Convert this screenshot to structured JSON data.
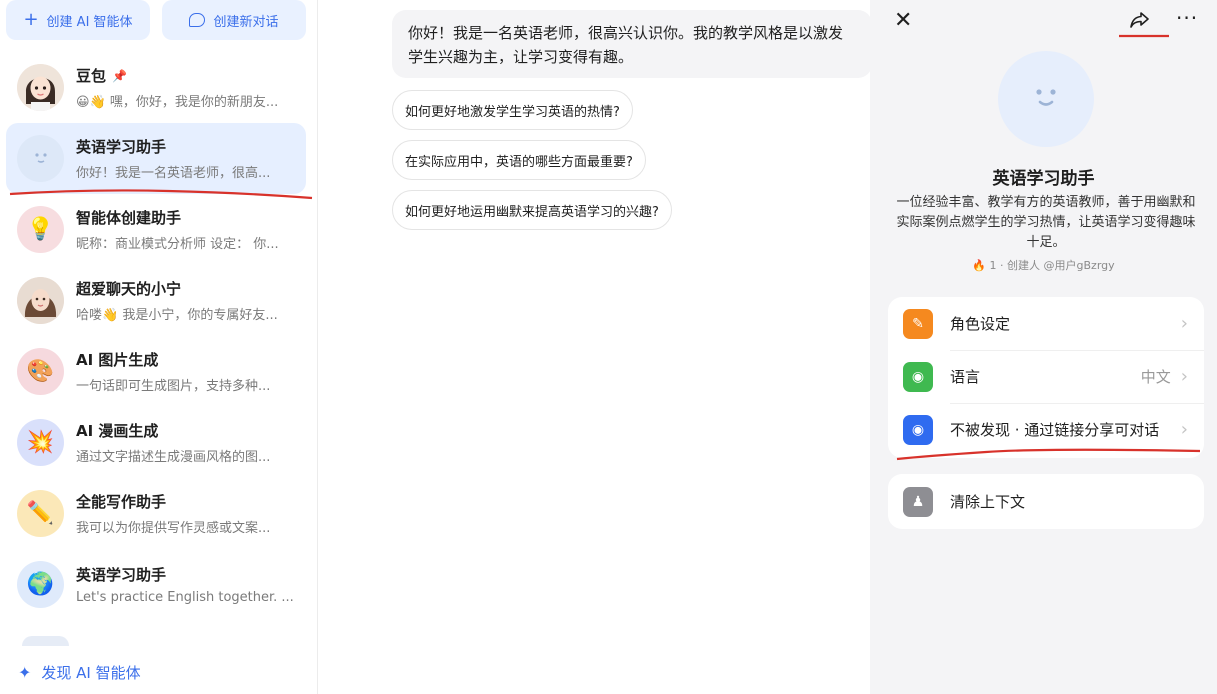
{
  "sidebar": {
    "create_agent_label": "创建 AI 智能体",
    "new_chat_label": "创建新对话",
    "agents": [
      {
        "name": "豆包",
        "desc": "😀👋 嘿，你好，我是你的新朋友...",
        "avatar": "girl",
        "pinned": true
      },
      {
        "name": "英语学习助手",
        "desc": "你好！我是一名英语老师，很高...",
        "avatar": "smile",
        "active": true
      },
      {
        "name": "智能体创建助手",
        "desc": "昵称：商业模式分析师 设定： 你...",
        "avatar": "bulb"
      },
      {
        "name": "超爱聊天的小宁",
        "desc": "哈喽👋 我是小宁，你的专属好友...",
        "avatar": "woman"
      },
      {
        "name": "AI 图片生成",
        "desc": "一句话即可生成图片，支持多种...",
        "avatar": "palette"
      },
      {
        "name": "AI 漫画生成",
        "desc": "通过文字描述生成漫画风格的图...",
        "avatar": "boom"
      },
      {
        "name": "全能写作助手",
        "desc": "我可以为你提供写作灵感或文案...",
        "avatar": "pencil"
      },
      {
        "name": "英语学习助手",
        "desc": "Let's practice English together. ...",
        "avatar": "globe"
      }
    ],
    "discover_label": "发现 AI 智能体"
  },
  "chat": {
    "greeting": "你好！我是一名英语老师，很高兴认识你。我的教学风格是以激发学生兴趣为主，让学习变得有趣。",
    "suggestions": [
      "如何更好地激发学生学习英语的热情?",
      "在实际应用中，英语的哪些方面最重要?",
      "如何更好地运用幽默来提高英语学习的兴趣?"
    ]
  },
  "panel": {
    "title": "英语学习助手",
    "description": "一位经验丰富、教学有方的英语教师，善于用幽默和实际案例点燃学生的学习热情，让英语学习变得趣味十足。",
    "meta": "1 · 创建人 @用户gBzrgy",
    "settings": [
      {
        "label": "角色设定",
        "value": "",
        "color": "#f5891f"
      },
      {
        "label": "语言",
        "value": "中文",
        "color": "#3fb950"
      },
      {
        "label": "不被发现 · 通过链接分享可对话",
        "value": "",
        "color": "#2f6bf0"
      }
    ],
    "clear_context_label": "清除上下文"
  }
}
